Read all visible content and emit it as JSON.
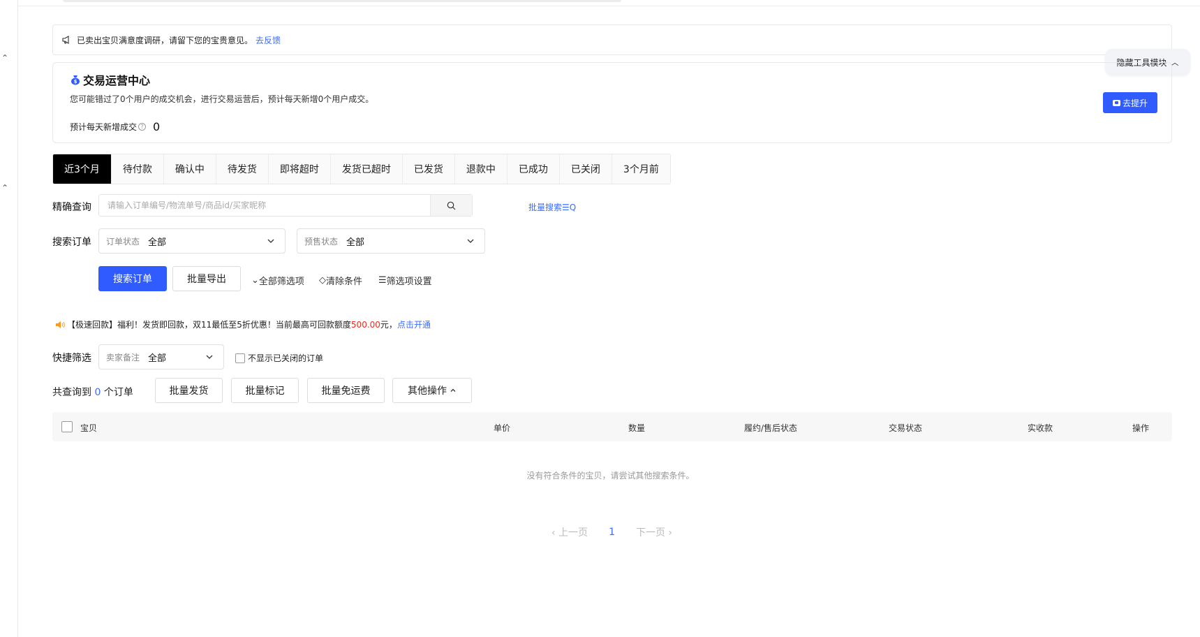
{
  "survey": {
    "text": "已卖出宝贝满意度调研，请留下您的宝贵意见。",
    "link": "去反馈"
  },
  "hide_tools": {
    "label": "隐藏工具模块"
  },
  "ops": {
    "title": "交易运营中心",
    "desc": "您可能错过了0个用户的成交机会，进行交易运营后，预计每天新增0个用户成交。",
    "est_label": "预计每天新增成交",
    "est_value": "0",
    "improve_label": "去提升"
  },
  "tabs": [
    "近3个月",
    "待付款",
    "确认中",
    "待发货",
    "即将超时",
    "发货已超时",
    "已发货",
    "退款中",
    "已成功",
    "已关闭",
    "3个月前"
  ],
  "query": {
    "label": "精确查询",
    "placeholder": "请输入订单编号/物流单号/商品id/买家昵称",
    "batch_search": "批量搜索"
  },
  "search_orders": {
    "label": "搜索订单",
    "order_status": {
      "label": "订单状态",
      "value": "全部"
    },
    "presale_status": {
      "label": "预售状态",
      "value": "全部"
    }
  },
  "actions": {
    "search": "搜索订单",
    "export": "批量导出",
    "all_filters": "全部筛选项",
    "clear": "清除条件",
    "filter_settings": "筛选项设置"
  },
  "promo": {
    "text1": "【极速回款】福利！发货即回款，双11最低至5折优惠！当前最高可回款额度",
    "amount": "500.00",
    "text2": "元，",
    "link": "点击开通"
  },
  "quick_filter": {
    "label": "快捷筛选",
    "remark": {
      "label": "卖家备注",
      "value": "全部"
    },
    "hide_closed": "不显示已关闭的订单"
  },
  "totals": {
    "prefix": "共查询到",
    "count": "0",
    "suffix": "个订单"
  },
  "bulk": {
    "ship": "批量发货",
    "mark": "批量标记",
    "free_ship": "批量免运费",
    "other": "其他操作"
  },
  "table": {
    "headers": [
      "宝贝",
      "单价",
      "数量",
      "履约/售后状态",
      "交易状态",
      "实收款",
      "操作"
    ],
    "empty": "没有符合条件的宝贝，请尝试其他搜索条件。"
  },
  "pager": {
    "prev": "上一页",
    "current": "1",
    "next": "下一页"
  }
}
